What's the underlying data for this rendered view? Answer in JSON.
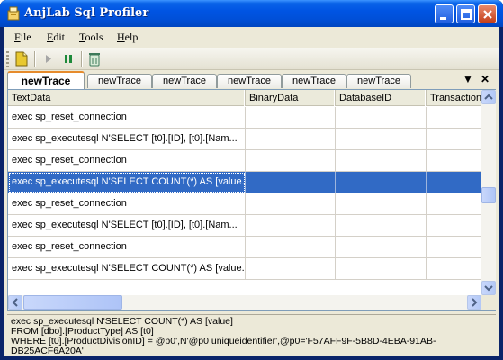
{
  "window": {
    "title": "AnjLab Sql Profiler",
    "accent": "#0054e3",
    "selection_color": "#316ac5"
  },
  "menu": [
    {
      "accel": "F",
      "rest": "ile"
    },
    {
      "accel": "E",
      "rest": "dit"
    },
    {
      "accel": "T",
      "rest": "ools"
    },
    {
      "accel": "H",
      "rest": "elp"
    }
  ],
  "toolbar": {
    "icons": [
      "new-trace-icon",
      "start-icon",
      "pause-icon",
      "clear-icon"
    ]
  },
  "tabs": [
    "newTrace",
    "newTrace",
    "newTrace",
    "newTrace",
    "newTrace",
    "newTrace"
  ],
  "tab_strip": {
    "menu_glyph": "▼",
    "close_glyph": "✕"
  },
  "grid": {
    "columns": [
      "TextData",
      "BinaryData",
      "DatabaseID",
      "TransactionID"
    ],
    "rows": [
      {
        "text": "exec sp_reset_connection"
      },
      {
        "text": "exec sp_executesql N'SELECT [t0].[ID], [t0].[Nam..."
      },
      {
        "text": "exec sp_reset_connection"
      },
      {
        "text": "exec sp_executesql N'SELECT COUNT(*) AS [value...",
        "selected": true
      },
      {
        "text": "exec sp_reset_connection"
      },
      {
        "text": "exec sp_executesql N'SELECT [t0].[ID], [t0].[Nam..."
      },
      {
        "text": "exec sp_reset_connection"
      },
      {
        "text": "exec sp_executesql N'SELECT COUNT(*) AS [value..."
      }
    ]
  },
  "detail": {
    "lines": [
      "exec sp_executesql N'SELECT COUNT(*) AS [value]",
      "FROM [dbo].[ProductType] AS [t0]",
      "WHERE [t0].[ProductDivisionID] = @p0',N'@p0 uniqueidentifier',@p0='F57AFF9F-5B8D-4EBA-91AB-",
      "DB25ACF6A20A'"
    ]
  }
}
